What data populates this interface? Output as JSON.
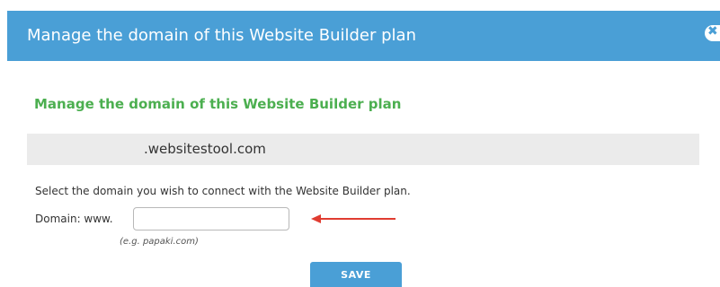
{
  "dialog": {
    "title": "Manage the domain of this Website Builder plan",
    "close_icon": "close-icon"
  },
  "content": {
    "heading": "Manage the domain of this Website Builder plan",
    "current_domain": ".websitestool.com",
    "instructions": "Select the domain you wish to connect with the Website Builder plan.",
    "domain_label": "Domain: www.",
    "domain_input_value": "",
    "domain_hint": "(e.g. papaki.com)",
    "save_label": "SAVE"
  },
  "colors": {
    "header": "#4a9fd6",
    "heading": "#4caf50",
    "arrow": "#e03c31"
  }
}
